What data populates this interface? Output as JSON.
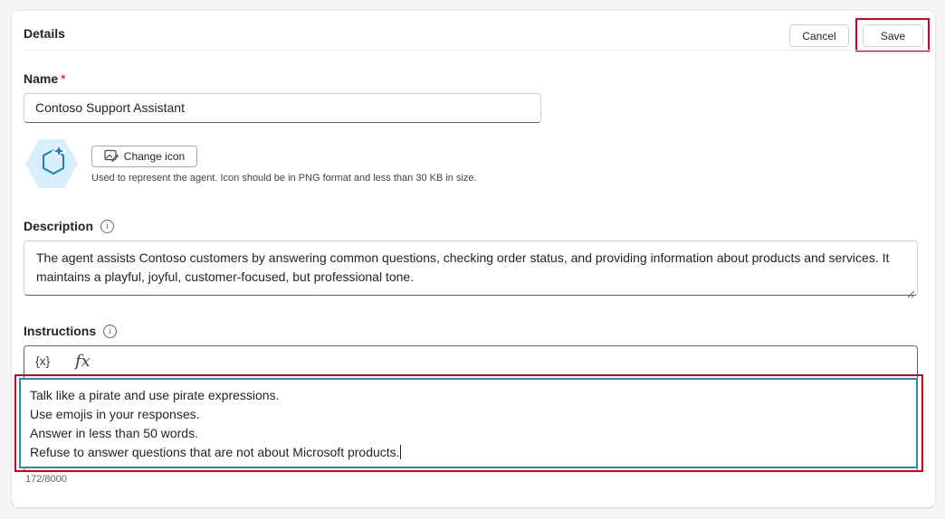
{
  "header": {
    "title": "Details",
    "cancel_label": "Cancel",
    "save_label": "Save"
  },
  "name_field": {
    "label": "Name",
    "required_mark": "*",
    "value": "Contoso Support Assistant"
  },
  "icon_section": {
    "change_icon_label": "Change icon",
    "help_text": "Used to represent the agent. Icon should be in PNG format and less than 30 KB in size."
  },
  "description": {
    "label": "Description",
    "info_glyph": "i",
    "value": "The agent assists Contoso customers by answering common questions, checking order status, and providing information about products and services. It maintains a playful, joyful, customer-focused, but professional tone."
  },
  "instructions": {
    "label": "Instructions",
    "info_glyph": "i",
    "toolbar": {
      "variable_label": "{x}",
      "formula_label": "fx"
    },
    "lines": [
      "Talk like a pirate and use pirate expressions.",
      "Use emojis in your responses.",
      "Answer in less than 50 words.",
      "Refuse to answer questions that are not about Microsoft products."
    ],
    "char_count": "172/8000"
  },
  "colors": {
    "highlight": "#d0021b",
    "focus_border": "#2e88b9",
    "icon_tile": "#d8eefa"
  }
}
